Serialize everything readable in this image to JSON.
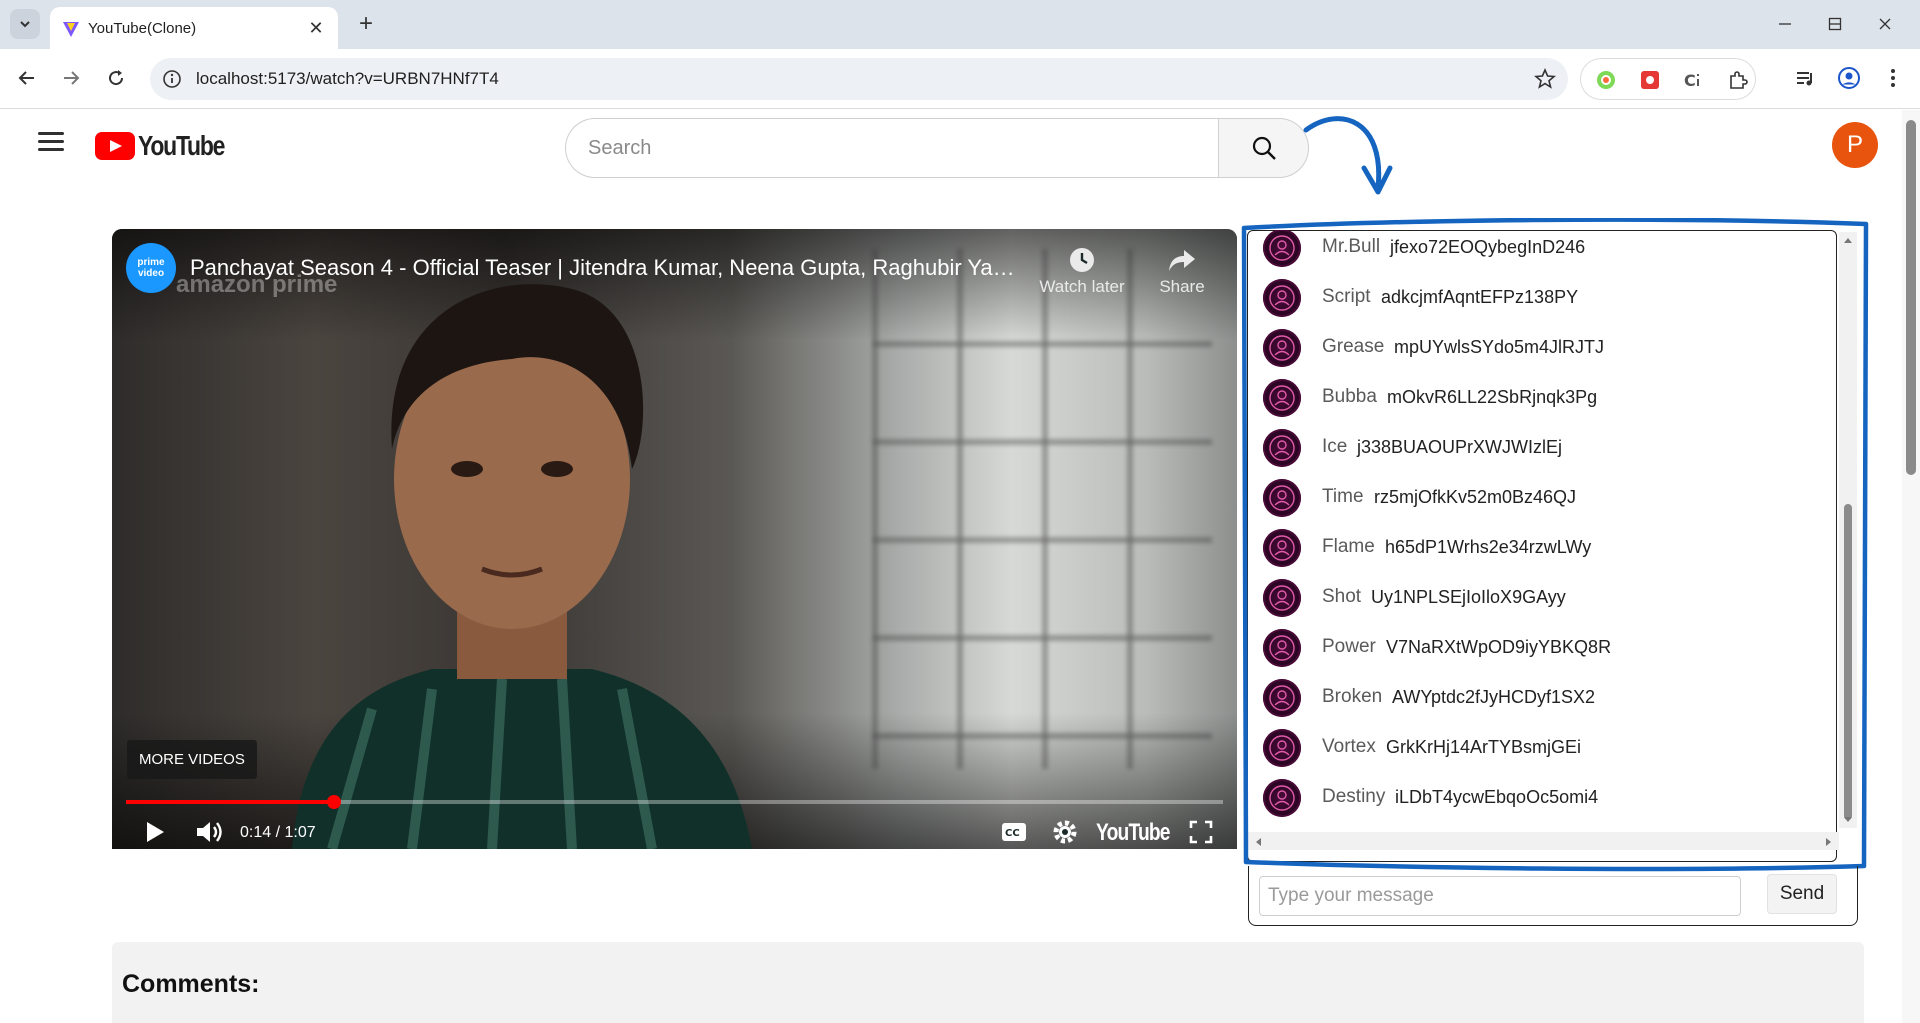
{
  "browser": {
    "tab_title": "YouTube(Clone)",
    "url": "localhost:5173/watch?v=URBN7HNf7T4"
  },
  "header": {
    "logo_text": "YouTube",
    "search_placeholder": "Search",
    "avatar_letter": "P"
  },
  "player": {
    "channel_logo": "prime video",
    "title": "Panchayat Season 4 - Official Teaser | Jitendra Kumar, Neena Gupta, Raghubir Yad...",
    "watermark": "amazon prime",
    "watch_later_label": "Watch later",
    "share_label": "Share",
    "more_videos_label": "MORE VIDEOS",
    "time": "0:14 / 1:07",
    "wordmark": "YouTube",
    "progress_fraction": 0.19
  },
  "chat": {
    "messages": [
      {
        "user": "Mr.Bull",
        "text": "jfexo72EOQybegInD246"
      },
      {
        "user": "Script",
        "text": "adkcjmfAqntEFPz138PY"
      },
      {
        "user": "Grease",
        "text": "mpUYwlsSYdo5m4JlRJTJ"
      },
      {
        "user": "Bubba",
        "text": "mOkvR6LL22SbRjnqk3Pg"
      },
      {
        "user": "Ice",
        "text": "j338BUAOUPrXWJWIzlEj"
      },
      {
        "user": "Time",
        "text": "rz5mjOfkKv52m0Bz46QJ"
      },
      {
        "user": "Flame",
        "text": "h65dP1Wrhs2e34rzwLWy"
      },
      {
        "user": "Shot",
        "text": "Uy1NPLSEjIoIloX9GAyy"
      },
      {
        "user": "Power",
        "text": "V7NaRXtWpOD9iyYBKQ8R"
      },
      {
        "user": "Broken",
        "text": "AWYptdc2fJyHCDyf1SX2"
      },
      {
        "user": "Vortex",
        "text": "GrkKrHj14ArTYBsmjGEi"
      },
      {
        "user": "Destiny",
        "text": "iLDbT4ycwEbqoOc5omi4"
      }
    ],
    "input_placeholder": "Type your message",
    "send_label": "Send"
  },
  "comments": {
    "title": "Comments:"
  },
  "colors": {
    "accent_red": "#ff0000",
    "annotation_blue": "#1565c0",
    "avatar_orange": "#e8540e"
  }
}
